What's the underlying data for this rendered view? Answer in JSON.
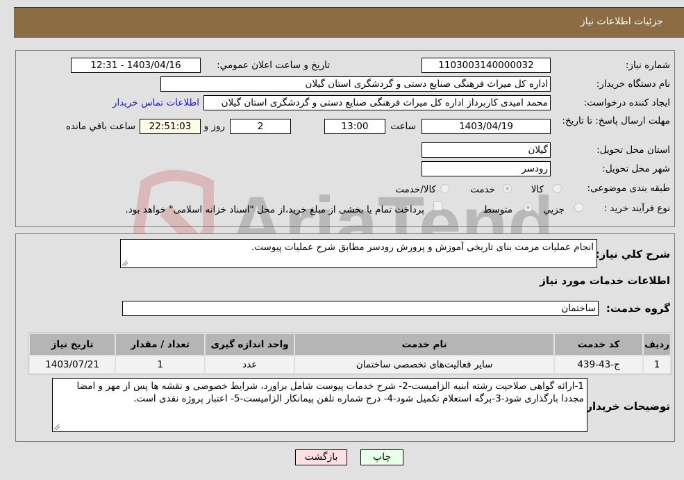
{
  "header": {
    "title": "جزئیات اطلاعات نیاز"
  },
  "form": {
    "need_number_label": "شماره نیاز:",
    "need_number": "1103003140000032",
    "announce_label": "تاریخ و ساعت اعلان عمومي:",
    "announce_value": "1403/04/16 - 12:31",
    "buyer_org_label": "نام دستگاه خریدار:",
    "buyer_org": "اداره کل میراث فرهنگی  صنایع دستی و گردشگری استان گیلان",
    "creator_label": "ایجاد کننده درخواست:",
    "creator": "محمد امیدی کاربرداز اداره کل میراث فرهنگی  صنایع دستی و گردشگری استان گیلان",
    "contact_link": "اطلاعات تماس خریدار",
    "deadline_label": "مهلت ارسال پاسخ: تا تاریخ:",
    "deadline_date": "1403/04/19",
    "time_label": "ساعت",
    "deadline_time": "13:00",
    "days_value": "2",
    "days_label": "روز و",
    "remaining_time": "22:51:03",
    "remaining_label": "ساعت باقي مانده",
    "province_label": "استان محل تحویل:",
    "province": "گیلان",
    "city_label": "شهر محل تحویل:",
    "city": "رودسر",
    "category_label": "طبقه بندی موضوعی:",
    "category_options": [
      {
        "label": "کالا",
        "checked": false
      },
      {
        "label": "خدمت",
        "checked": true
      },
      {
        "label": "کالا/خدمت",
        "checked": false
      }
    ],
    "process_label": "نوع فرآیند خرید :",
    "process_options": [
      {
        "label": "جزيي",
        "checked": false
      },
      {
        "label": "متوسط",
        "checked": true
      }
    ],
    "treasury_note": "پرداخت تمام یا بخشی از مبلغ خرید،از محل \"اسناد خزانه اسلامی\" خواهد بود.",
    "treasury_checked": false
  },
  "details": {
    "description_label": "شرح کلي نیاز:",
    "description": "انجام عملیات مرمت بنای تاریخی آموزش و پرورش رودسر مطابق شرح عملیات پیوست.",
    "services_title": "اطلاعات خدمات مورد نیاز",
    "service_group_label": "گروه خدمت:",
    "service_group": "ساختمان",
    "table": {
      "headers": [
        "ردیف",
        "کد خدمت",
        "نام خدمت",
        "واحد اندازه گیری",
        "تعداد / مقدار",
        "تاریخ نیاز"
      ],
      "rows": [
        [
          "1",
          "ج-43-439",
          "سایر فعالیت‌های تخصصی ساختمان",
          "عدد",
          "1",
          "1403/07/21"
        ]
      ]
    },
    "buyer_notes_label": "توضیحات خریدار:",
    "buyer_notes": "1-ارائه گواهی صلاحیت رشته ابنیه الزامیست-2- شرح خدمات پیوست شامل براورد، شرایط خصوصی و نقشه ها پس از مهر و امضا مجددا بارگذاری شود-3-برگه استعلام تکمیل شود-4- درج شماره تلفن پیمانکار الزامیست-5- اعتبار پروژه نقدی است."
  },
  "buttons": {
    "print": "چاپ",
    "back": "بازگشت"
  },
  "watermark": {
    "text": "AriaTender.neT"
  },
  "colors": {
    "header_bg": "#8c6c43",
    "print_bg": "#eaffea",
    "back_bg": "#ffe0e0",
    "link": "#1a1adb"
  }
}
